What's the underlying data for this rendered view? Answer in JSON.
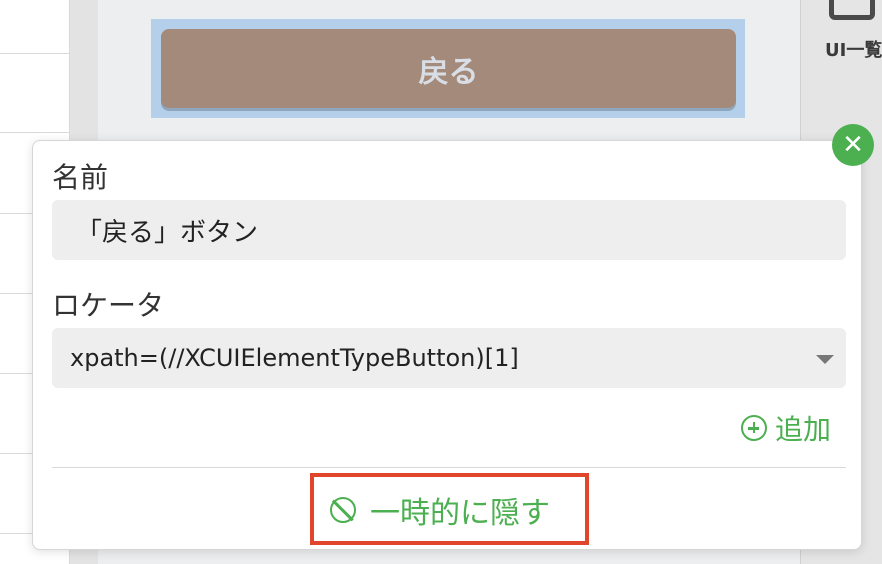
{
  "phone": {
    "back_button_label": "戻る"
  },
  "right_panel": {
    "ui_list_label": "UI一覧",
    "ui_list_icon": "ui-list-icon"
  },
  "popover": {
    "close_icon": "close-icon",
    "name_label": "名前",
    "name_value": "「戻る」ボタン",
    "locator_label": "ロケータ",
    "locator_value": "xpath=(//XCUIElementTypeButton)[1]",
    "add_label": "追加",
    "hide_label": "一時的に隠す"
  },
  "colors": {
    "accent_green": "#4caf50",
    "highlight_red": "#e0462c",
    "selection_blue": "#b3cfe9",
    "back_button_brown": "#a48a7a"
  }
}
